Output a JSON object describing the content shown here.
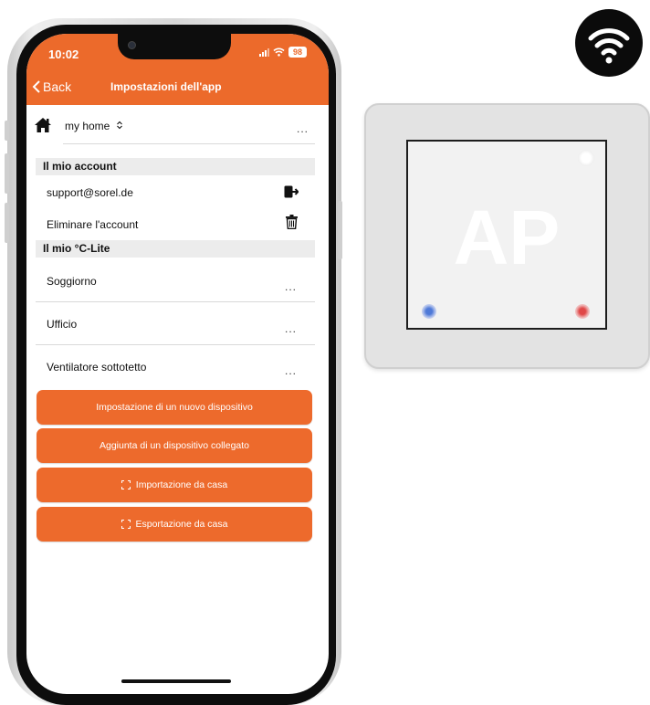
{
  "status_bar": {
    "time": "10:02",
    "battery": "98"
  },
  "nav": {
    "back_label": "Back",
    "title": "Impostazioni dell'app"
  },
  "home": {
    "name": "my home",
    "more": "..."
  },
  "account_section": {
    "title": "Il mio account",
    "email": "support@sorel.de",
    "delete_label": "Eliminare l'account"
  },
  "devices_section": {
    "title": "Il mio °C-Lite",
    "items": [
      {
        "label": "Soggiorno",
        "more": "..."
      },
      {
        "label": "Ufficio",
        "more": "..."
      },
      {
        "label": "Ventilatore sottotetto",
        "more": "..."
      }
    ]
  },
  "actions": {
    "new_device": "Impostazione di un nuovo dispositivo",
    "add_linked": "Aggiunta di un dispositivo collegato",
    "import_home": "Importazione da casa",
    "export_home": "Esportazione da casa"
  },
  "device": {
    "label": "AP"
  },
  "colors": {
    "accent": "#ec6a2b",
    "header": "#ec6a2b",
    "section_bg": "#ececec"
  },
  "icons": [
    "house-icon",
    "logout-icon",
    "trash-icon",
    "scan-icon",
    "wifi-icon"
  ]
}
